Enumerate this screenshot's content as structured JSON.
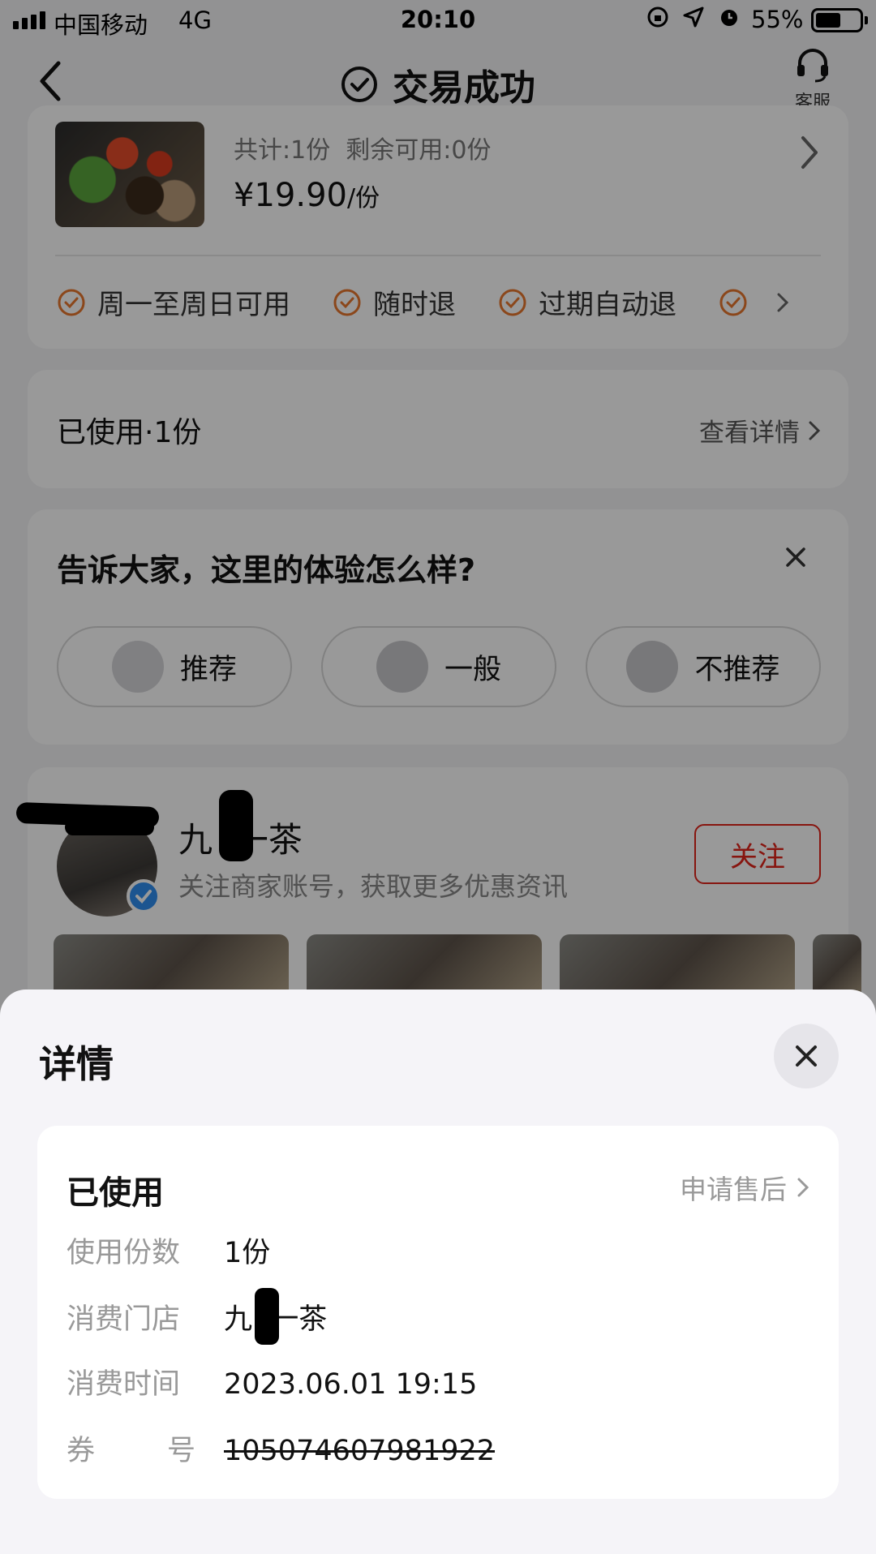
{
  "status_bar": {
    "carrier": "中国移动",
    "network": "4G",
    "time": "20:10",
    "battery": "55%"
  },
  "nav": {
    "title": "交易成功",
    "service_label": "客服"
  },
  "order": {
    "quantity_text": "共计:1份  剩余可用:0份",
    "price": "¥19.90",
    "price_unit": "/份",
    "tags": [
      "周一至周日可用",
      "随时退",
      "过期自动退"
    ]
  },
  "usage": {
    "title": "已使用·1份",
    "detail_link": "查看详情"
  },
  "review": {
    "question": "告诉大家，这里的体验怎么样?",
    "options": [
      "推荐",
      "一般",
      "不推荐"
    ]
  },
  "shop": {
    "name": "九  一茶",
    "subtitle": "关注商家账号，获取更多优惠资讯",
    "follow_label": "关注"
  },
  "sheet": {
    "title": "详情",
    "status": "已使用",
    "after_sale_link": "申请售后",
    "rows": [
      {
        "label": "使用份数",
        "value": "1份"
      },
      {
        "label": "消费门店",
        "value": "九  一茶"
      },
      {
        "label": "消费时间",
        "value": "2023.06.01 19:15"
      },
      {
        "label": "券        号",
        "value": "105074607981922"
      }
    ]
  },
  "colors": {
    "accent_red": "#e2231a",
    "tag_orange": "#e8772e",
    "verify_blue": "#2f8ef0"
  }
}
